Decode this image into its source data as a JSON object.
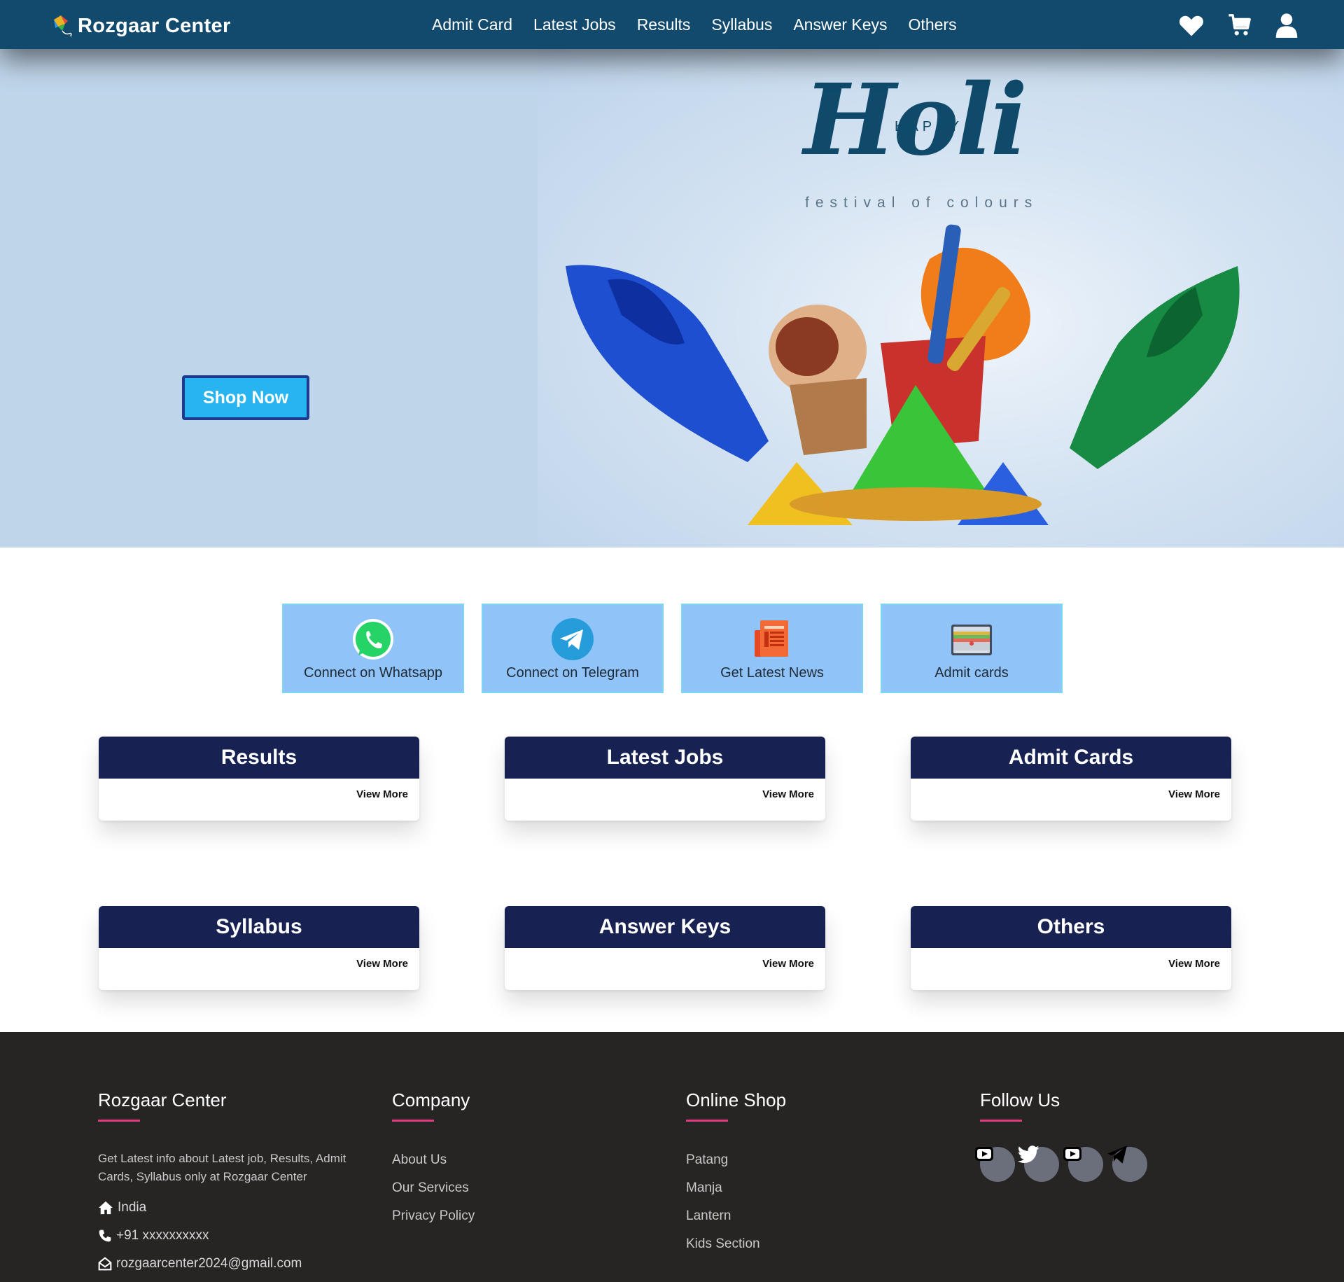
{
  "nav": {
    "brand": "Rozgaar Center",
    "links": [
      "Admit Card",
      "Latest Jobs",
      "Results",
      "Syllabus",
      "Answer Keys",
      "Others"
    ],
    "icons": [
      "heart-icon",
      "cart-icon",
      "user-icon"
    ]
  },
  "hero": {
    "happy": "HAPPY",
    "title": "Holi",
    "subtitle": "festival of colours",
    "cta": "Shop Now"
  },
  "quick_links": [
    {
      "label": "Connect on Whatsapp",
      "icon": "whatsapp-icon"
    },
    {
      "label": "Connect on Telegram",
      "icon": "telegram-icon"
    },
    {
      "label": "Get Latest News",
      "icon": "news-icon"
    },
    {
      "label": "Admit cards",
      "icon": "card-icon"
    }
  ],
  "categories": [
    {
      "title": "Results",
      "more": "View More"
    },
    {
      "title": "Latest Jobs",
      "more": "View More"
    },
    {
      "title": "Admit Cards",
      "more": "View More"
    },
    {
      "title": "Syllabus",
      "more": "View More"
    },
    {
      "title": "Answer Keys",
      "more": "View More"
    },
    {
      "title": "Others",
      "more": "View More"
    }
  ],
  "footer": {
    "about": {
      "title": "Rozgaar Center",
      "desc": "Get Latest info about Latest job, Results, Admit Cards, Syllabus only at Rozgaar Center",
      "location": "India",
      "phone": "+91 xxxxxxxxxx",
      "email": "rozgaarcenter2024@gmail.com"
    },
    "company": {
      "title": "Company",
      "links": [
        "About Us",
        "Our Services",
        "Privacy Policy"
      ]
    },
    "shop": {
      "title": "Online Shop",
      "links": [
        "Patang",
        "Manja",
        "Lantern",
        "Kids Section"
      ]
    },
    "follow": {
      "title": "Follow Us",
      "icons": [
        "youtube-icon",
        "twitter-icon",
        "youtube-icon",
        "telegram-icon"
      ]
    }
  },
  "colors": {
    "nav_bg": "#124a6e",
    "hero_bg": "#bfd5ea",
    "quick_bg": "#90c3f7",
    "card_head": "#182252",
    "footer_bg": "#272424",
    "accent": "#e13c80"
  }
}
